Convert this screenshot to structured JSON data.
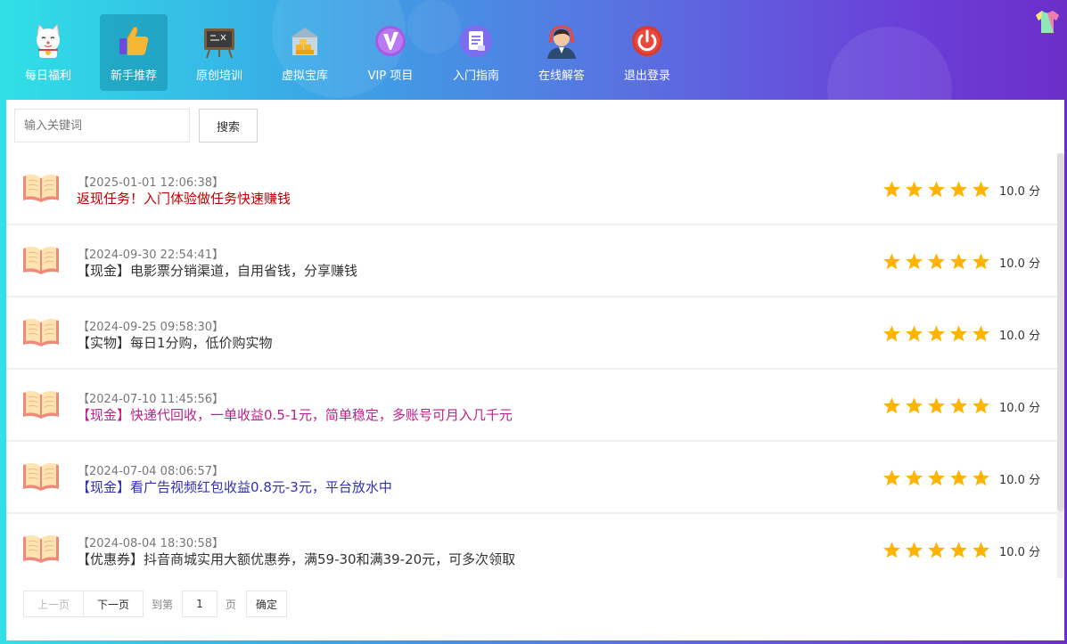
{
  "nav": {
    "items": [
      {
        "label": "每日福利",
        "icon": "lucky-cat-icon"
      },
      {
        "label": "新手推荐",
        "icon": "thumbs-up-icon"
      },
      {
        "label": "原创培训",
        "icon": "blackboard-icon"
      },
      {
        "label": "虚拟宝库",
        "icon": "treasure-house-icon"
      },
      {
        "label": "VIP 项目",
        "icon": "vip-icon"
      },
      {
        "label": "入门指南",
        "icon": "document-icon"
      },
      {
        "label": "在线解答",
        "icon": "support-agent-icon"
      },
      {
        "label": "退出登录",
        "icon": "power-icon"
      }
    ],
    "active_index": 1,
    "skin_icon": "tshirt-icon"
  },
  "search": {
    "placeholder": "输入关键词",
    "value": "",
    "button_label": "搜索"
  },
  "list": {
    "items": [
      {
        "date": "【2025-01-01 12:06:38】",
        "title": "返现任务！入门体验做任务快速赚钱",
        "color": "#c00000",
        "rating_stars": 5,
        "score": "10.0 分"
      },
      {
        "date": "【2024-09-30 22:54:41】",
        "title": "【现金】电影票分销渠道，自用省钱，分享赚钱",
        "color": "#333333",
        "rating_stars": 5,
        "score": "10.0 分"
      },
      {
        "date": "【2024-09-25 09:58:30】",
        "title": "【实物】每日1分购，低价购实物",
        "color": "#333333",
        "rating_stars": 5,
        "score": "10.0 分"
      },
      {
        "date": "【2024-07-10 11:45:56】",
        "title": "【现金】快递代回收，一单收益0.5-1元，简单稳定，多账号可月入几千元",
        "color": "#c0208a",
        "rating_stars": 5,
        "score": "10.0 分"
      },
      {
        "date": "【2024-07-04 08:06:57】",
        "title": "【现金】看广告视频红包收益0.8元-3元，平台放水中",
        "color": "#3030b0",
        "rating_stars": 5,
        "score": "10.0 分"
      },
      {
        "date": "【2024-08-04 18:30:58】",
        "title": "【优惠券】抖音商城实用大额优惠券，满59-30和满39-20元，可多次领取",
        "color": "#333333",
        "rating_stars": 5,
        "score": "10.0 分"
      }
    ],
    "star_color": "#ffb400",
    "row_icon": "open-book-icon"
  },
  "pager": {
    "prev_label": "上一页",
    "next_label": "下一页",
    "goto_label": "到第",
    "page_value": "1",
    "page_unit": "页",
    "confirm_label": "确定"
  }
}
